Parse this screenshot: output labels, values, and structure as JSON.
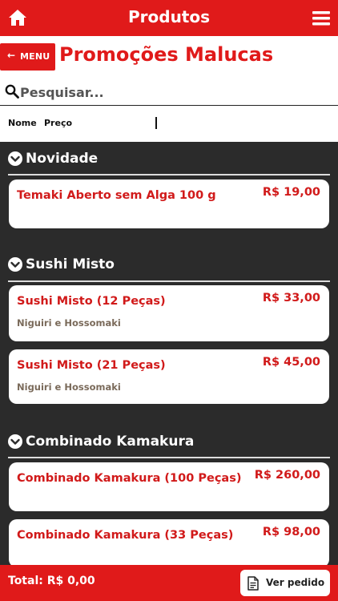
{
  "header": {
    "title": "Produtos"
  },
  "nav": {
    "back_label": "MENU"
  },
  "category": {
    "title": "Promoções Malucas"
  },
  "search": {
    "placeholder": "Pesquisar..."
  },
  "sort": {
    "name_label": "Nome",
    "price_label": "Preço"
  },
  "sections": [
    {
      "title": "Novidade",
      "items": [
        {
          "name": "Temaki Aberto sem Alga 100 g",
          "price": "R$ 19,00",
          "description": ""
        }
      ]
    },
    {
      "title": "Sushi Misto",
      "items": [
        {
          "name": "Sushi Misto (12 Peças)",
          "price": "R$ 33,00",
          "description": "Niguiri e Hossomaki"
        },
        {
          "name": "Sushi Misto (21 Peças)",
          "price": "R$ 45,00",
          "description": "Niguiri e Hossomaki"
        }
      ]
    },
    {
      "title": "Combinado Kamakura",
      "items": [
        {
          "name": "Combinado Kamakura (100 Peças)",
          "price": "R$ 260,00",
          "description": ""
        },
        {
          "name": "Combinado Kamakura (33 Peças)",
          "price": "R$ 98,00",
          "description": ""
        }
      ]
    }
  ],
  "footer": {
    "total": "Total: R$ 0,00",
    "order_button": "Ver pedido"
  },
  "colors": {
    "brand_red": "#e01a1a",
    "background": "#2b2b2b",
    "card_text": "#d11a1a"
  }
}
